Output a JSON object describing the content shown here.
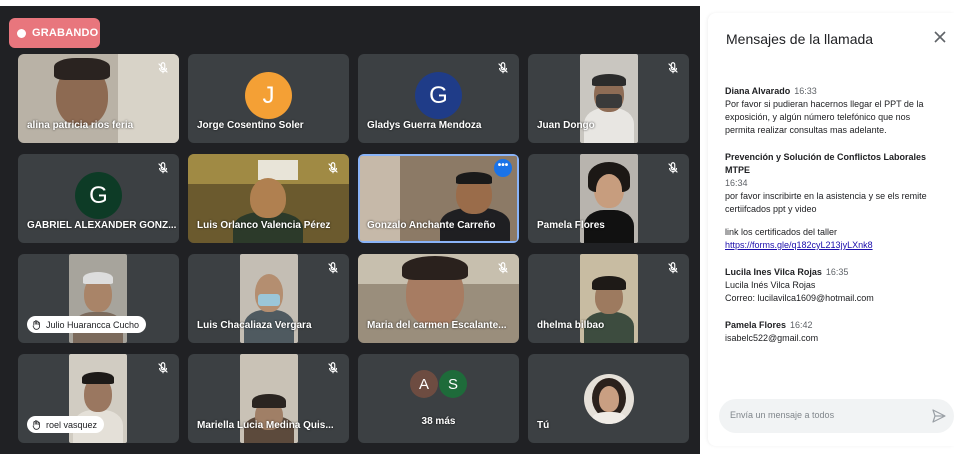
{
  "recording": {
    "label": "GRABANDO"
  },
  "participants": [
    {
      "name": "alina patricia rios feria"
    },
    {
      "name": "Jorge Cosentino Soler",
      "initial": "J"
    },
    {
      "name": "Gladys Guerra Mendoza",
      "initial": "G"
    },
    {
      "name": "Juan Dongo"
    },
    {
      "name": "GABRIEL ALEXANDER GONZ...",
      "initial": "G"
    },
    {
      "name": "Luis Orlanco Valencia Pérez"
    },
    {
      "name": "Gonzalo Anchante Carreño"
    },
    {
      "name": "Pamela Flores"
    },
    {
      "name": "Julio Huarancca Cucho"
    },
    {
      "name": "Luis Chacaliaza Vergara"
    },
    {
      "name": "Maria del carmen Escalante..."
    },
    {
      "name": "dhelma bilbao"
    },
    {
      "name": "roel vasquez"
    },
    {
      "name": "Mariella Lucia Medina Quis..."
    },
    {
      "name": "38 más",
      "initials": [
        "A",
        "S"
      ]
    },
    {
      "name": "Tú"
    }
  ],
  "chat": {
    "title": "Mensajes de la llamada",
    "messages": [
      {
        "sender": "Diana Alvarado",
        "time": "16:33",
        "lines": [
          "Por favor si pudieran hacernos llegar el PPT de la",
          "exposición, y algún número telefónico que nos",
          "permita realizar consultas mas adelante."
        ]
      },
      {
        "sender": "Prevención y Solución de Conflictos Laborales MTPE",
        "time": "16:34",
        "lines": [
          "por favor inscribirte en la asistencia y se els remite",
          "certiifcados ppt y video"
        ],
        "extra": "link  los certificados del taller",
        "link": "https://forms.gle/q182cyL213jyLXnk8"
      },
      {
        "sender": "Lucila Ines Vilca Rojas",
        "time": "16:35",
        "lines": [
          "Lucila Inés Vilca Rojas",
          "Correo: lucilavilca1609@hotmail.com"
        ]
      },
      {
        "sender": "Pamela Flores",
        "time": "16:42",
        "lines": [
          "isabelc522@gmail.com"
        ]
      }
    ],
    "input_placeholder": "Envía un mensaje a todos"
  },
  "colors": {
    "recording": "#e8767d",
    "tile_bg": "#3c4043",
    "stage_bg": "#202124",
    "avatar_j": "#f4a035",
    "avatar_g_blue": "#1f3c88",
    "avatar_g_green": "#0d3b26",
    "avatar_a": "#6d4c41",
    "avatar_s": "#1e6b3a",
    "link": "#1a0dab"
  },
  "icons": {
    "mic_off": "mic-off-icon",
    "close": "close-icon",
    "send": "send-icon",
    "hand": "raised-hand-icon",
    "more": "more-options-icon"
  }
}
